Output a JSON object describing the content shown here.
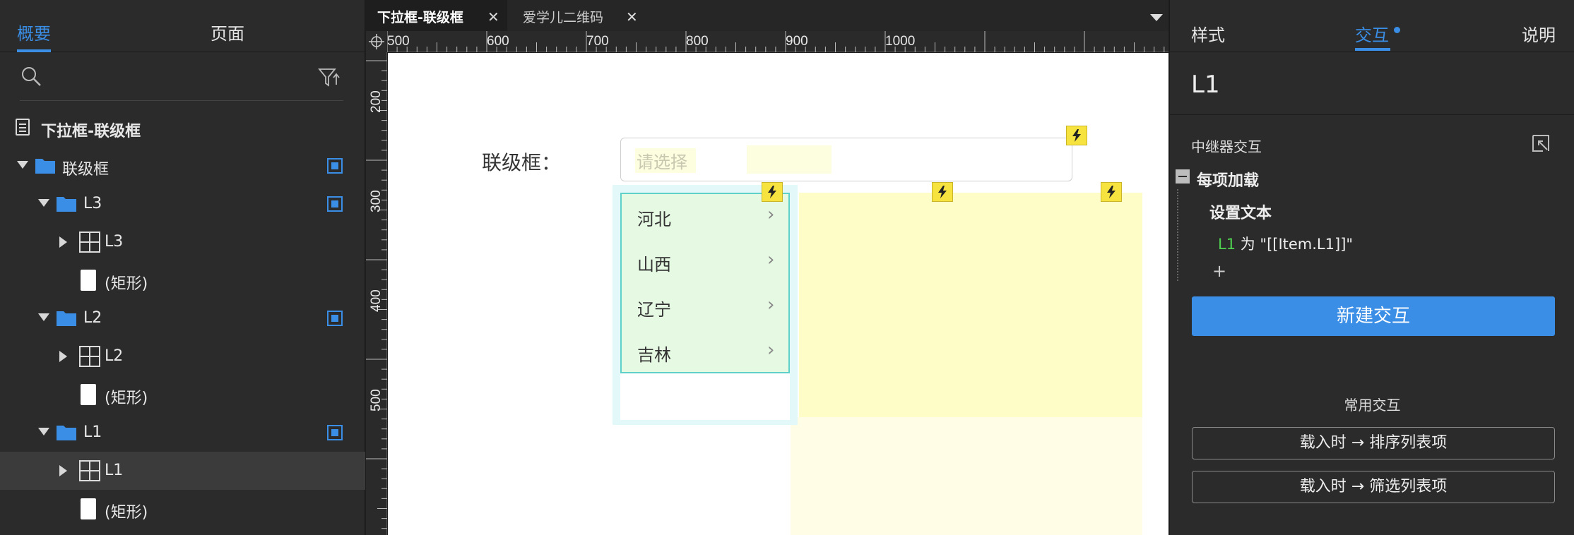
{
  "left_panel": {
    "tabs": [
      "概要",
      "页面"
    ],
    "page_title": "下拉框-联级框",
    "tree": [
      {
        "label": "联级框"
      },
      {
        "label": "L3"
      },
      {
        "label": "L3"
      },
      {
        "label": "(矩形)"
      },
      {
        "label": "L2"
      },
      {
        "label": "L2"
      },
      {
        "label": "(矩形)"
      },
      {
        "label": "L1"
      },
      {
        "label": "L1"
      },
      {
        "label": "(矩形)"
      }
    ]
  },
  "doc_tabs": [
    {
      "label": "下拉框-联级框",
      "active": true
    },
    {
      "label": "爱学儿二维码",
      "active": false
    }
  ],
  "rulers": {
    "top": [
      "500",
      "600",
      "700",
      "800",
      "900",
      "1000"
    ],
    "left": [
      "200",
      "300",
      "400",
      "500"
    ]
  },
  "canvas": {
    "field_label": "联级框：",
    "select_placeholder": "请选择",
    "list_items": [
      "河北",
      "山西",
      "辽宁",
      "吉林"
    ],
    "chevron": "›"
  },
  "right_panel": {
    "tabs": [
      "样式",
      "交互",
      "说明"
    ],
    "widget_name": "L1",
    "repeater_title": "中继器交互",
    "event": "每项加载",
    "action": "设置文本",
    "action_target": "L1",
    "action_rest": " 为 \"[[Item.L1]]\"",
    "add": "+",
    "new_interaction": "新建交互",
    "common_title": "常用交互",
    "quick": [
      "载入时 → 排序列表项",
      "载入时 → 筛选列表项"
    ]
  },
  "colors": {
    "accent": "#3a8ee6",
    "panel_bg": "#2b2b2b",
    "bolt": "#f7e33f",
    "list_bg": "#e6fae3",
    "highlight_yellow": "#fffdc7"
  }
}
